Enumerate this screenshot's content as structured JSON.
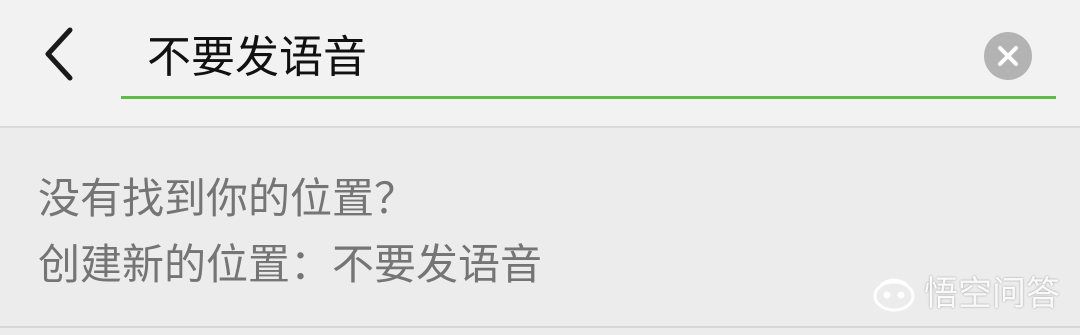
{
  "colors": {
    "accent": "#5fbb46",
    "background": "#ececec",
    "search_bar_bg": "#f2f2f2",
    "primary_text": "#111111",
    "secondary_text": "#757575",
    "clear_button_bg": "#b3b3b3"
  },
  "header": {
    "back_icon": "chevron-left-icon",
    "search": {
      "value": "不要发语音",
      "clear_icon": "close-circle-icon"
    }
  },
  "result": {
    "not_found_text": "没有找到你的位置？",
    "create_text": "创建新的位置：不要发语音"
  },
  "watermark": {
    "logo_icon": "wukong-logo-icon",
    "text": "悟空问答"
  }
}
